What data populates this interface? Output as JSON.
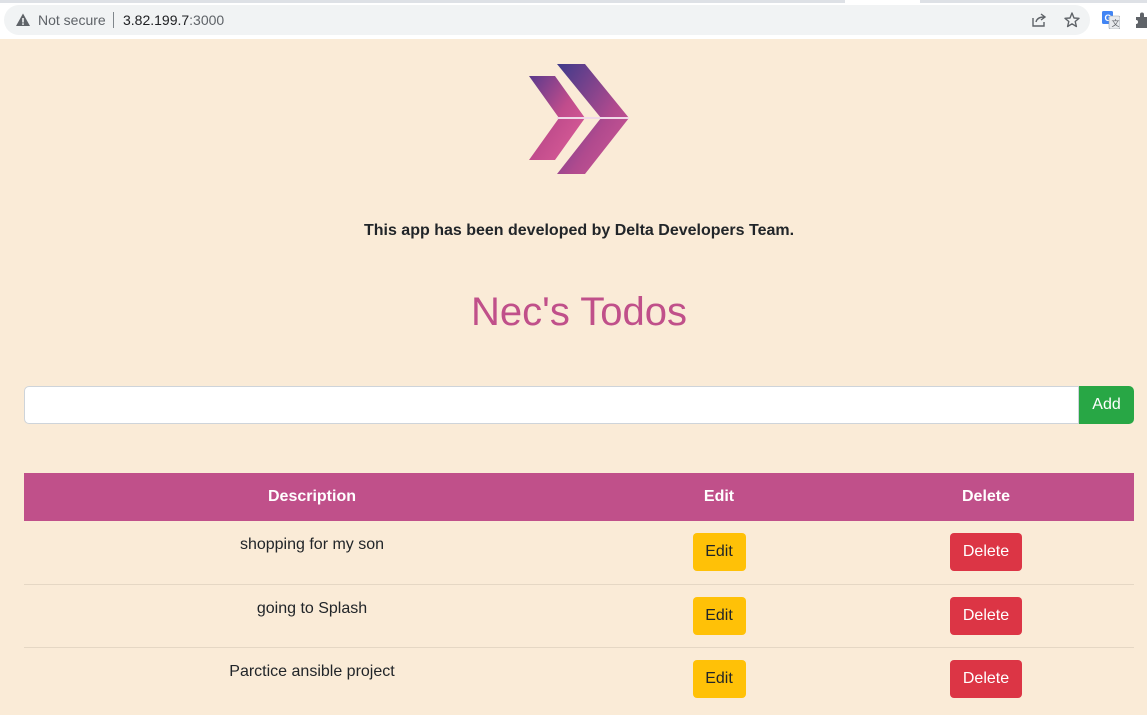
{
  "browser": {
    "security_label": "Not secure",
    "url_host": "3.82.199.7",
    "url_port": ":3000",
    "icons": [
      "warning-icon",
      "share-icon",
      "star-icon",
      "translate-icon",
      "extensions-icon"
    ]
  },
  "page": {
    "credit": "This app has been developed by Delta Developers Team.",
    "title": "Nec's Todos",
    "input": {
      "value": "",
      "placeholder": ""
    },
    "add_label": "Add",
    "table": {
      "headers": {
        "description": "Description",
        "edit": "Edit",
        "delete": "Delete"
      },
      "rows": [
        {
          "description": "shopping for my son",
          "edit_label": "Edit",
          "delete_label": "Delete"
        },
        {
          "description": "going to Splash",
          "edit_label": "Edit",
          "delete_label": "Delete"
        },
        {
          "description": "Parctice ansible project",
          "edit_label": "Edit",
          "delete_label": "Delete"
        }
      ]
    }
  },
  "colors": {
    "background": "#faebd7",
    "accent": "#c0508a",
    "add_button": "#28a745",
    "edit_button": "#ffc107",
    "delete_button": "#dc3545"
  }
}
